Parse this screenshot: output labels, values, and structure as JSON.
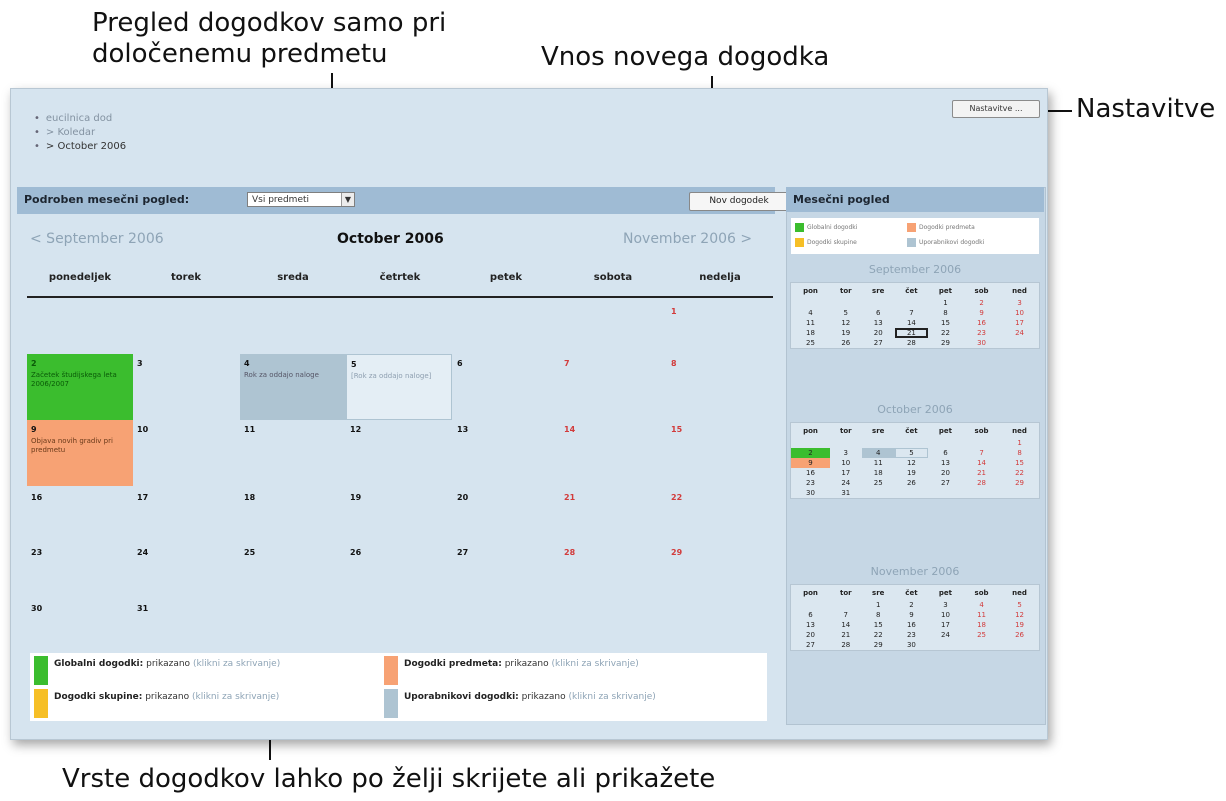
{
  "callouts": {
    "subject_filter": "Pregled dogodkov samo pri\ndoločenemu predmetu",
    "new_event": "Vnos novega dogodka",
    "settings": "Nastavitve",
    "event_types": "Vrste dogodkov lahko po želji skrijete ali prikažete"
  },
  "breadcrumb": [
    "eucilnica dod",
    "> Koledar",
    "> October 2006"
  ],
  "settings_button": "Nastavitve ...",
  "main": {
    "title": "Podroben mesečni pogled:",
    "filter_value": "Vsi predmeti",
    "new_event_button": "Nov dogodek",
    "prev_month": "< September 2006",
    "current_month": "October 2006",
    "next_month": "November 2006 >",
    "days": [
      "ponedeljek",
      "torek",
      "sreda",
      "četrtek",
      "petek",
      "sobota",
      "nedelja"
    ],
    "events": {
      "oct2": "Začetek študijskega leta 2006/2007",
      "oct4": "Rok za oddajo naloge",
      "oct5": "[Rok za oddajo naloge]",
      "oct9": "Objava novih gradiv pri predmetu"
    }
  },
  "legend": {
    "global": {
      "label": "Globalni dogodki:",
      "state": "prikazano",
      "link": "(klikni za skrivanje)"
    },
    "course": {
      "label": "Dogodki predmeta:",
      "state": "prikazano",
      "link": "(klikni za skrivanje)"
    },
    "group": {
      "label": "Dogodki skupine:",
      "state": "prikazano",
      "link": "(klikni za skrivanje)"
    },
    "user": {
      "label": "Uporabnikovi dogodki:",
      "state": "prikazano",
      "link": "(klikni za skrivanje)"
    }
  },
  "sidebar": {
    "title": "Mesečni pogled",
    "legend": [
      "Globalni dogodki",
      "Dogodki predmeta",
      "Dogodki skupine",
      "Uporabnikovi dogodki"
    ],
    "weekdays": [
      "pon",
      "tor",
      "sre",
      "čet",
      "pet",
      "sob",
      "ned"
    ],
    "months": {
      "september": "September 2006",
      "october": "October 2006",
      "november": "November 2006"
    }
  },
  "colors": {
    "global": "#3bbd2e",
    "course": "#f7a274",
    "group": "#f6bf26",
    "user": "#aec4d2",
    "weekend": "#d23b3b"
  }
}
